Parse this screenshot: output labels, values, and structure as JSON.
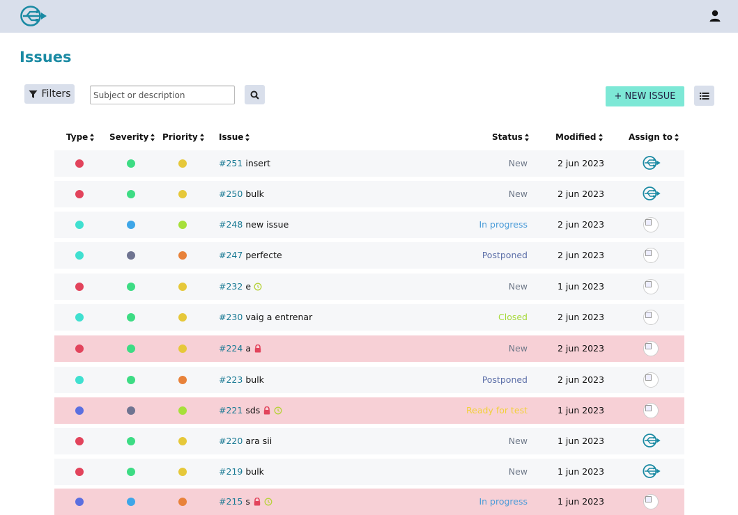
{
  "header": {
    "logo_icon": "usb-taiga-logo-icon",
    "user_icon": "user-icon"
  },
  "page": {
    "title": "Issues"
  },
  "toolbar": {
    "filters_label": "Filters",
    "search_placeholder": "Subject or description",
    "new_issue_label": "+ NEW ISSUE"
  },
  "table": {
    "columns": {
      "type": "Type",
      "severity": "Severity",
      "priority": "Priority",
      "issue": "Issue",
      "status": "Status",
      "modified": "Modified",
      "assign_to": "Assign to"
    },
    "rows": [
      {
        "type_color": "#e2445c",
        "severity_color": "#3ddc84",
        "priority_color": "#e6c83a",
        "number": "#251",
        "subject": "insert",
        "blocked": false,
        "clock": false,
        "status": "New",
        "status_color": "#707a8a",
        "modified": "2 jun 2023",
        "assignee": "logo"
      },
      {
        "type_color": "#e2445c",
        "severity_color": "#3ddc84",
        "priority_color": "#e6c83a",
        "number": "#250",
        "subject": "bulk",
        "blocked": false,
        "clock": false,
        "status": "New",
        "status_color": "#707a8a",
        "modified": "2 jun 2023",
        "assignee": "logo"
      },
      {
        "type_color": "#40e0d0",
        "severity_color": "#3ea6e8",
        "priority_color": "#a6e03a",
        "number": "#248",
        "subject": "new issue",
        "blocked": false,
        "clock": false,
        "status": "In progress",
        "status_color": "#4a9bd8",
        "modified": "2 jun 2023",
        "assignee": "avatar"
      },
      {
        "type_color": "#40e0d0",
        "severity_color": "#6f7491",
        "priority_color": "#e8823a",
        "number": "#247",
        "subject": "perfecte",
        "blocked": false,
        "clock": false,
        "status": "Postponed",
        "status_color": "#5c6fa8",
        "modified": "2 jun 2023",
        "assignee": "avatar"
      },
      {
        "type_color": "#e2445c",
        "severity_color": "#3ddc84",
        "priority_color": "#e6c83a",
        "number": "#232",
        "subject": "e",
        "blocked": false,
        "clock": true,
        "status": "New",
        "status_color": "#707a8a",
        "modified": "1 jun 2023",
        "assignee": "avatar"
      },
      {
        "type_color": "#40e0d0",
        "severity_color": "#3ddc84",
        "priority_color": "#e6c83a",
        "number": "#230",
        "subject": "vaig a entrenar",
        "blocked": false,
        "clock": false,
        "status": "Closed",
        "status_color": "#a6d93a",
        "modified": "2 jun 2023",
        "assignee": "avatar"
      },
      {
        "type_color": "#e2445c",
        "severity_color": "#3ddc84",
        "priority_color": "#e6c83a",
        "number": "#224",
        "subject": "a",
        "blocked": true,
        "clock": false,
        "status": "New",
        "status_color": "#707a8a",
        "modified": "2 jun 2023",
        "assignee": "avatar"
      },
      {
        "type_color": "#40e0d0",
        "severity_color": "#3ddc84",
        "priority_color": "#e8823a",
        "number": "#223",
        "subject": "bulk",
        "blocked": false,
        "clock": false,
        "status": "Postponed",
        "status_color": "#5c6fa8",
        "modified": "2 jun 2023",
        "assignee": "avatar"
      },
      {
        "type_color": "#5b6fe0",
        "severity_color": "#6f7491",
        "priority_color": "#a6e03a",
        "number": "#221",
        "subject": "sds",
        "blocked": true,
        "clock": true,
        "status": "Ready for test",
        "status_color": "#f2d03a",
        "modified": "1 jun 2023",
        "assignee": "avatar"
      },
      {
        "type_color": "#e2445c",
        "severity_color": "#3ddc84",
        "priority_color": "#e6c83a",
        "number": "#220",
        "subject": "ara sii",
        "blocked": false,
        "clock": false,
        "status": "New",
        "status_color": "#707a8a",
        "modified": "1 jun 2023",
        "assignee": "logo"
      },
      {
        "type_color": "#e2445c",
        "severity_color": "#3ddc84",
        "priority_color": "#e6c83a",
        "number": "#219",
        "subject": "bulk",
        "blocked": false,
        "clock": false,
        "status": "New",
        "status_color": "#707a8a",
        "modified": "1 jun 2023",
        "assignee": "logo"
      },
      {
        "type_color": "#5b6fe0",
        "severity_color": "#3ea6e8",
        "priority_color": "#e8823a",
        "number": "#215",
        "subject": "s",
        "blocked": true,
        "clock": true,
        "status": "In progress",
        "status_color": "#4a9bd8",
        "modified": "1 jun 2023",
        "assignee": "avatar"
      }
    ]
  }
}
